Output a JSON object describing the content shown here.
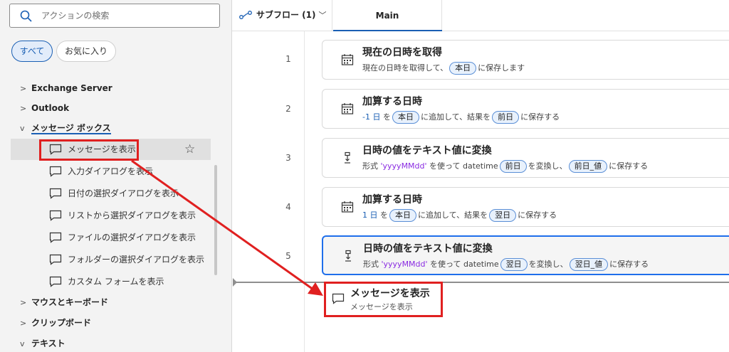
{
  "search": {
    "placeholder": "アクションの検索"
  },
  "filters": {
    "all": "すべて",
    "favorites": "お気に入り"
  },
  "tree": {
    "groups_top": [
      {
        "label": "Exchange Server",
        "chevron": ">"
      },
      {
        "label": "Outlook",
        "chevron": ">"
      }
    ],
    "open_group": {
      "label": "メッセージ ボックス",
      "chevron": "v"
    },
    "leaves": [
      "メッセージを表示",
      "入力ダイアログを表示",
      "日付の選択ダイアログを表示",
      "リストから選択ダイアログを表示",
      "ファイルの選択ダイアログを表示",
      "フォルダーの選択ダイアログを表示",
      "カスタム フォームを表示"
    ],
    "groups_bottom": [
      {
        "label": "マウスとキーボード",
        "chevron": ">"
      },
      {
        "label": "クリップボード",
        "chevron": ">"
      },
      {
        "label": "テキスト",
        "chevron": "v"
      }
    ]
  },
  "tabs": {
    "subflow": "サブフロー (1)",
    "main": "Main"
  },
  "steps": [
    {
      "num": "1",
      "title": "現在の日時を取得",
      "icon": "calendar-icon",
      "desc": {
        "pre": "現在の日時を取得して、",
        "t1": "本日",
        "post": "に保存します"
      }
    },
    {
      "num": "2",
      "title": "加算する日時",
      "icon": "calendar-icon",
      "desc": {
        "val": "-1 日",
        "a": "を",
        "t1": "本日",
        "b": "に追加して、結果を",
        "t2": "前日",
        "c": "に保存する"
      }
    },
    {
      "num": "3",
      "title": "日時の値をテキスト値に変換",
      "icon": "convert-icon",
      "desc": {
        "a": "形式",
        "fmt": "'yyyyMMdd'",
        "b": "を使って datetime",
        "t1": "前日",
        "c": "を変換し、",
        "t2": "前日_値",
        "d": "に保存する"
      }
    },
    {
      "num": "4",
      "title": "加算する日時",
      "icon": "calendar-icon",
      "desc": {
        "val": "1 日",
        "a": "を",
        "t1": "本日",
        "b": "に追加して、結果を",
        "t2": "翌日",
        "c": "に保存する"
      }
    },
    {
      "num": "5",
      "title": "日時の値をテキスト値に変換",
      "icon": "convert-icon",
      "desc": {
        "a": "形式",
        "fmt": "'yyyyMMdd'",
        "b": "を使って datetime",
        "t1": "翌日",
        "c": "を変換し、",
        "t2": "翌日_値",
        "d": "に保存する"
      }
    }
  ],
  "drag_preview": {
    "title": "メッセージを表示",
    "subtitle": "メッセージを表示"
  },
  "colors": {
    "accent": "#1a5fb4",
    "highlight": "#e02020",
    "token_border": "#5b8fd6"
  }
}
